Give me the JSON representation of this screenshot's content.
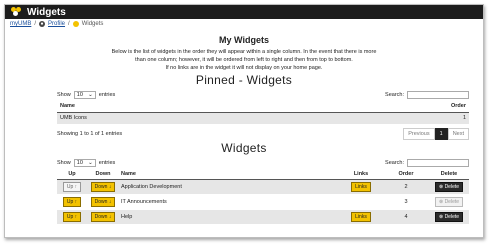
{
  "window": {
    "title": "Widgets"
  },
  "breadcrumb": {
    "items": [
      "myUMB",
      "Profile",
      "Widgets"
    ]
  },
  "page": {
    "heading": "My Widgets",
    "intro_line1": "Below is the list of widgets in the order they will appear within a single column. In the event that there is more",
    "intro_line2": "than one column; however, it will be ordered from left to right and then from top to bottom.",
    "intro_line3": "If no links are in the widget it will not display on your home page."
  },
  "pinned": {
    "title": "Pinned - Widgets",
    "show_label": "Show",
    "page_size": "10",
    "entries_label": "entries",
    "search_label": "Search:",
    "columns": {
      "name": "Name",
      "order": "Order"
    },
    "rows": [
      {
        "name": "UMB Icons",
        "order": "1"
      }
    ],
    "info": "Showing 1 to 1 of 1 entries",
    "pager": {
      "previous": "Previous",
      "current": "1",
      "next": "Next"
    }
  },
  "widgets": {
    "title": "Widgets",
    "show_label": "Show",
    "page_size": "10",
    "entries_label": "entries",
    "search_label": "Search:",
    "columns": {
      "up": "Up",
      "down": "Down",
      "name": "Name",
      "links": "Links",
      "order": "Order",
      "delete": "Delete"
    },
    "up_label": "Up ↑",
    "down_label": "Down ↓",
    "links_label": "Links",
    "delete_label": "Delete",
    "rows": [
      {
        "name": "Application Development",
        "order": "2"
      },
      {
        "name": "IT Announcements",
        "order": "3"
      },
      {
        "name": "Help",
        "order": "4"
      }
    ]
  },
  "colors": {
    "accent": "#f3c200",
    "titlebar": "#1c1c1c",
    "row_stripe": "#e6e6e6"
  }
}
